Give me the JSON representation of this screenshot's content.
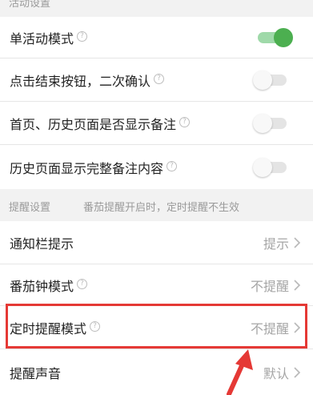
{
  "sections": {
    "activity_header": "活动设置",
    "reminder_header": "提醒设置",
    "reminder_note": "番茄提醒开启时，定时提醒不生效"
  },
  "activity": [
    {
      "label": "单活动模式",
      "help": true,
      "toggle": "on"
    },
    {
      "label": "点击结束按钮，二次确认",
      "help": true,
      "toggle": "off"
    },
    {
      "label": "首页、历史页面是否显示备注",
      "help": true,
      "toggle": "off"
    },
    {
      "label": "历史页面显示完整备注内容",
      "help": true,
      "toggle": "off"
    }
  ],
  "reminder": [
    {
      "label": "通知栏提示",
      "help": false,
      "value": "提示"
    },
    {
      "label": "番茄钟模式",
      "help": true,
      "value": "不提醒"
    },
    {
      "label": "定时提醒模式",
      "help": true,
      "value": "不提醒"
    },
    {
      "label": "提醒声音",
      "help": false,
      "value": "默认"
    }
  ],
  "icons": {
    "help": "question-circle-icon",
    "chevron": "chevron-right-icon"
  },
  "colors": {
    "accent_green": "#4caf50",
    "annotation_red": "#e53935"
  }
}
